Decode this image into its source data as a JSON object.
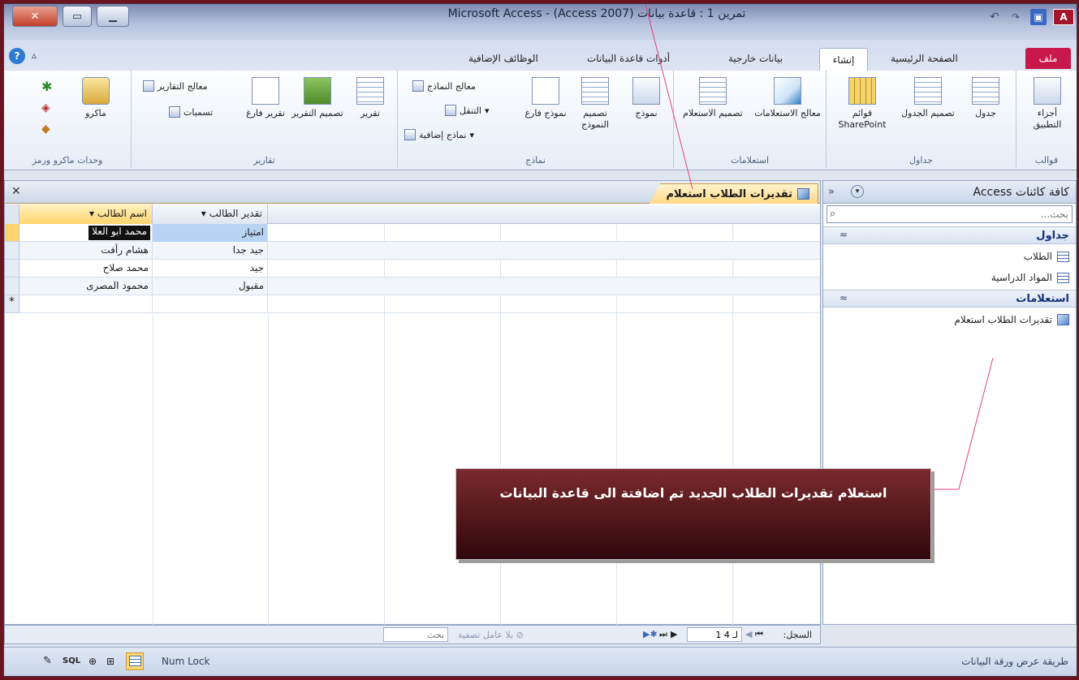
{
  "window": {
    "title": "Microsoft Access - (Access 2007) تمرين 1 : قاعدة بيانات"
  },
  "tabs": [
    "ملف",
    "الصفحة الرئيسية",
    "إنشاء",
    "بيانات خارجية",
    "أدوات قاعدة البيانات",
    "الوظائف الإضافية"
  ],
  "ribbon": {
    "templates": {
      "label": "قوالب",
      "app_parts": "أجزاء التطبيق"
    },
    "tables": {
      "label": "جداول",
      "table": "جدول",
      "table_design": "تصميم الجدول",
      "sharepoint": "قوائم SharePoint"
    },
    "queries": {
      "label": "استعلامات",
      "wizard": "معالج الاستعلامات",
      "design": "تصميم الاستعلام"
    },
    "forms": {
      "label": "نماذج",
      "form": "نموذج",
      "form_design": "تصميم النموذج",
      "blank_form": "نموذج فارغ",
      "form_wizard": "معالج النماذج",
      "navigation": "التنقل",
      "more_forms": "نماذج إضافية"
    },
    "reports": {
      "label": "تقارير",
      "report": "تقرير",
      "report_design": "تصميم التقرير",
      "blank_report": "تقرير فارغ",
      "report_wizard": "معالج التقارير",
      "labels": "تسميات"
    },
    "macros": {
      "label": "وحدات ماكرو ورمز",
      "macro": "ماكرو"
    }
  },
  "nav": {
    "title": "كافة كائنات Access",
    "search_placeholder": "بحث...",
    "tables_section": "جداول",
    "tables": [
      "الطلاب",
      "المواد الدراسية"
    ],
    "queries_section": "استعلامات",
    "queries": [
      "تقديرات الطلاب استعلام"
    ]
  },
  "doc": {
    "tab_title": "تقديرات الطلاب استعلام",
    "columns": [
      "اسم الطالب",
      "تقدير الطالب"
    ],
    "rows": [
      [
        "محمد ابو العلا",
        "امتياز"
      ],
      [
        "هشام رأفت",
        "جيد جدا"
      ],
      [
        "محمد صلاح",
        "جيد"
      ],
      [
        "محمود المصرى",
        "مقبول"
      ]
    ],
    "new_row_marker": "*"
  },
  "record_nav": {
    "label": "السجل:",
    "position": "1 لـ 4",
    "filter": "بلا عامل تصفية",
    "search": "بحث"
  },
  "status": {
    "left": "طريقة عرض ورقة البيانات",
    "numlock": "Num Lock",
    "sql": "SQL"
  },
  "callout": {
    "text": "استعلام تقديرات الطلاب الجديد تم اضافتة الى قاعدة البيانات"
  }
}
